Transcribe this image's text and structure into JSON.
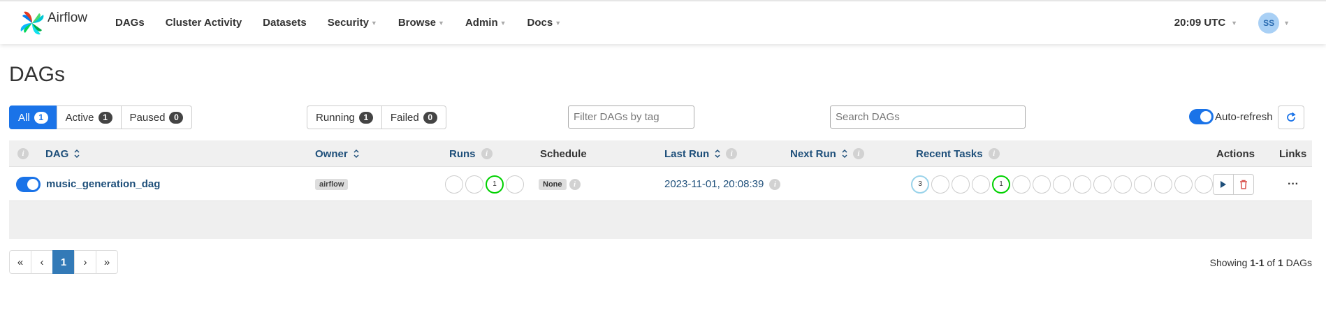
{
  "brand": {
    "name": "Airflow"
  },
  "nav": {
    "items": [
      {
        "label": "DAGs",
        "dropdown": false
      },
      {
        "label": "Cluster Activity",
        "dropdown": false
      },
      {
        "label": "Datasets",
        "dropdown": false
      },
      {
        "label": "Security",
        "dropdown": true
      },
      {
        "label": "Browse",
        "dropdown": true
      },
      {
        "label": "Admin",
        "dropdown": true
      },
      {
        "label": "Docs",
        "dropdown": true
      }
    ],
    "time": "20:09 UTC",
    "user_initials": "SS"
  },
  "page": {
    "title": "DAGs"
  },
  "filters": {
    "status": [
      {
        "label": "All",
        "count": "1",
        "active": true
      },
      {
        "label": "Active",
        "count": "1",
        "active": false
      },
      {
        "label": "Paused",
        "count": "0",
        "active": false
      }
    ],
    "run_state": [
      {
        "label": "Running",
        "count": "1"
      },
      {
        "label": "Failed",
        "count": "0"
      }
    ],
    "tag_placeholder": "Filter DAGs by tag",
    "search_placeholder": "Search DAGs",
    "auto_refresh_label": "Auto-refresh",
    "auto_refresh_on": true
  },
  "table": {
    "headers": {
      "dag": "DAG",
      "owner": "Owner",
      "runs": "Runs",
      "schedule": "Schedule",
      "last_run": "Last Run",
      "next_run": "Next Run",
      "recent_tasks": "Recent Tasks",
      "actions": "Actions",
      "links": "Links"
    },
    "info_glyph": "i",
    "rows": [
      {
        "dag_id": "music_generation_dag",
        "active": true,
        "owner": "airflow",
        "runs": [
          "",
          "",
          "1",
          ""
        ],
        "schedule": "None",
        "last_run": "2023-11-01, 20:08:39",
        "next_run": "",
        "recent_tasks": [
          "3",
          "",
          "",
          "",
          "1",
          "",
          "",
          "",
          "",
          "",
          "",
          "",
          "",
          "",
          ""
        ],
        "links_label": "···"
      }
    ]
  },
  "pagination": {
    "items": [
      "«",
      "‹",
      "1",
      "›",
      "»"
    ],
    "active_index": 2,
    "showing_prefix": "Showing",
    "showing_range": "1-1",
    "showing_of": "of",
    "showing_total": "1",
    "showing_suffix": "DAGs"
  },
  "colors": {
    "primary": "#1a73e8",
    "success": "#00d100",
    "queued": "#9ad3ea",
    "delete": "#d9534f",
    "link": "#1e4f7a"
  }
}
